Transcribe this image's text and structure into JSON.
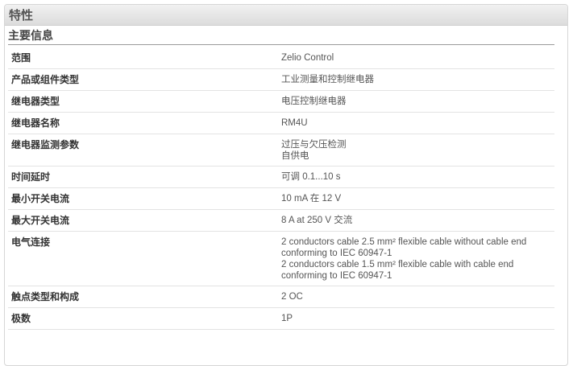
{
  "panel": {
    "title": "特性"
  },
  "section": {
    "title": "主要信息"
  },
  "rows": [
    {
      "label": "范围",
      "lines": [
        "Zelio Control"
      ]
    },
    {
      "label": "产品或组件类型",
      "lines": [
        "工业测量和控制继电器"
      ]
    },
    {
      "label": "继电器类型",
      "lines": [
        "电压控制继电器"
      ]
    },
    {
      "label": "继电器名称",
      "lines": [
        "RM4U"
      ]
    },
    {
      "label": "继电器监测参数",
      "lines": [
        "过压与欠压检测",
        "自供电"
      ]
    },
    {
      "label": "时间延时",
      "lines": [
        "可调 0.1...10 s"
      ]
    },
    {
      "label": "最小开关电流",
      "lines": [
        "10 mA 在 12 V"
      ]
    },
    {
      "label": "最大开关电流",
      "lines": [
        "8 A at 250 V 交流"
      ]
    },
    {
      "label": "电气连接",
      "lines": [
        "2 conductors cable 2.5 mm² flexible cable without cable end",
        "conforming to IEC 60947-1",
        "2 conductors cable 1.5 mm² flexible cable with cable end",
        "conforming to IEC 60947-1"
      ]
    },
    {
      "label": "触点类型和构成",
      "lines": [
        "2 OC"
      ]
    },
    {
      "label": "极数",
      "lines": [
        "1P"
      ]
    }
  ]
}
